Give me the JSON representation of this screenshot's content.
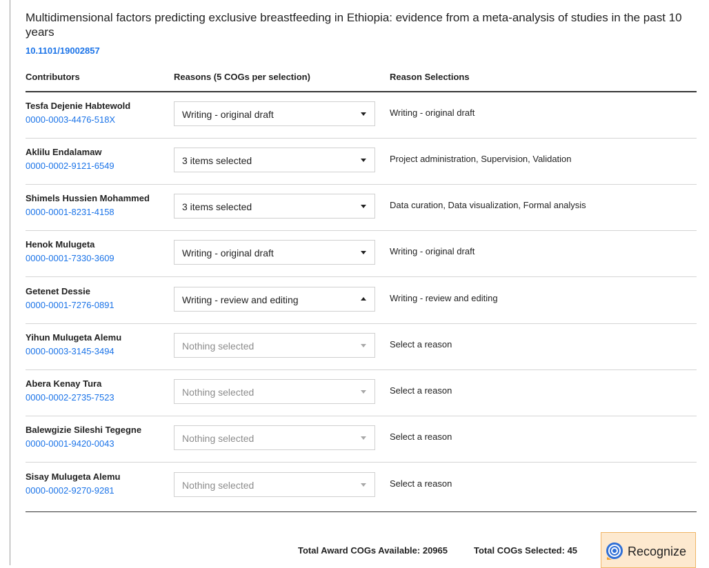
{
  "paper": {
    "title": "Multidimensional factors predicting exclusive breastfeeding in Ethiopia: evidence from a meta-analysis of studies in the past 10 years",
    "doi": "10.1101/19002857"
  },
  "columns": {
    "contributors": "Contributors",
    "reasons": "Reasons (5 COGs per selection)",
    "selections": "Reason Selections"
  },
  "rows": [
    {
      "name": "Tesfa Dejenie Habtewold",
      "orcid": "0000-0003-4476-518X",
      "dropdown": "Writing - original draft",
      "selection": "Writing - original draft"
    },
    {
      "name": "Aklilu Endalamaw",
      "orcid": "0000-0002-9121-6549",
      "dropdown": "3 items selected",
      "selection": "Project administration, Supervision, Validation"
    },
    {
      "name": "Shimels Hussien Mohammed",
      "orcid": "0000-0001-8231-4158",
      "dropdown": "3 items selected",
      "selection": "Data curation, Data visualization, Formal analysis"
    },
    {
      "name": "Henok Mulugeta",
      "orcid": "0000-0001-7330-3609",
      "dropdown": "Writing - original draft",
      "selection": "Writing - original draft"
    },
    {
      "name": "Getenet Dessie",
      "orcid": "0000-0001-7276-0891",
      "dropdown": "Writing - review and editing",
      "selection": "Writing - review and editing"
    },
    {
      "name": "Yihun Mulugeta Alemu",
      "orcid": "0000-0003-3145-3494",
      "dropdown": "Nothing selected",
      "selection": "Select a reason"
    },
    {
      "name": "Abera Kenay Tura",
      "orcid": "0000-0002-2735-7523",
      "dropdown": "Nothing selected",
      "selection": "Select a reason"
    },
    {
      "name": "Balewgizie Sileshi Tegegne",
      "orcid": "0000-0001-9420-0043",
      "dropdown": "Nothing selected",
      "selection": "Select a reason"
    },
    {
      "name": "Sisay Mulugeta Alemu",
      "orcid": "0000-0002-9270-9281",
      "dropdown": "Nothing selected",
      "selection": "Select a reason"
    }
  ],
  "footer": {
    "available": "Total Award COGs Available: 20965",
    "selected": "Total COGs Selected: 45",
    "recognize_label": "Recognize"
  },
  "colors": {
    "link": "#1a73e8",
    "accent_button_bg": "#fde9cf",
    "accent_button_border": "#f0b466"
  }
}
